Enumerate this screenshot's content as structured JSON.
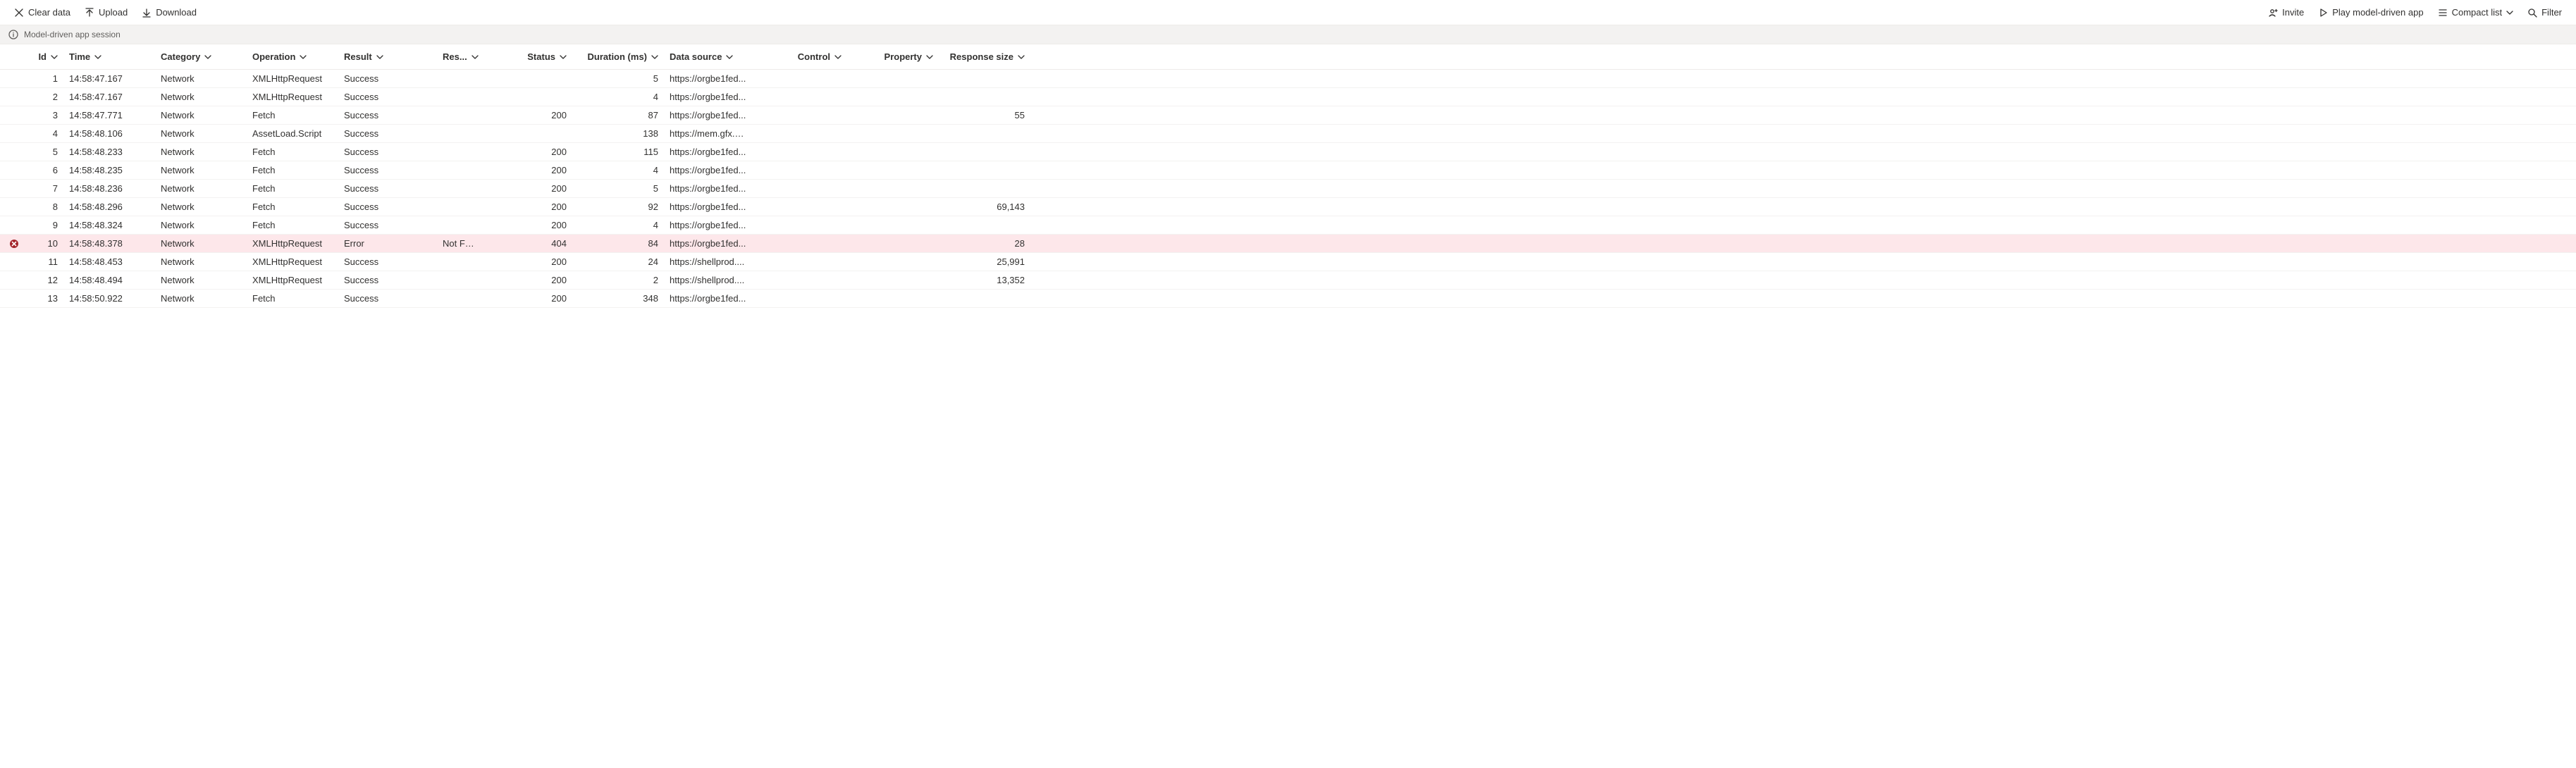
{
  "toolbar": {
    "clear_label": "Clear data",
    "upload_label": "Upload",
    "download_label": "Download",
    "invite_label": "Invite",
    "play_label": "Play model-driven app",
    "compact_label": "Compact list",
    "filter_label": "Filter"
  },
  "session": {
    "label": "Model-driven app session"
  },
  "columns": {
    "id": "Id",
    "time": "Time",
    "category": "Category",
    "operation": "Operation",
    "result": "Result",
    "resultinfo": "Res...",
    "status": "Status",
    "duration": "Duration (ms)",
    "datasource": "Data source",
    "control": "Control",
    "property": "Property",
    "responsesize": "Response size"
  },
  "rows": [
    {
      "id": "1",
      "time": "14:58:47.167",
      "category": "Network",
      "operation": "XMLHttpRequest",
      "result": "Success",
      "resultinfo": "",
      "status": "",
      "duration": "5",
      "datasource": "https://orgbe1fed...",
      "control": "",
      "property": "",
      "responsesize": "",
      "error": false
    },
    {
      "id": "2",
      "time": "14:58:47.167",
      "category": "Network",
      "operation": "XMLHttpRequest",
      "result": "Success",
      "resultinfo": "",
      "status": "",
      "duration": "4",
      "datasource": "https://orgbe1fed...",
      "control": "",
      "property": "",
      "responsesize": "",
      "error": false
    },
    {
      "id": "3",
      "time": "14:58:47.771",
      "category": "Network",
      "operation": "Fetch",
      "result": "Success",
      "resultinfo": "",
      "status": "200",
      "duration": "87",
      "datasource": "https://orgbe1fed...",
      "control": "",
      "property": "",
      "responsesize": "55",
      "error": false
    },
    {
      "id": "4",
      "time": "14:58:48.106",
      "category": "Network",
      "operation": "AssetLoad.Script",
      "result": "Success",
      "resultinfo": "",
      "status": "",
      "duration": "138",
      "datasource": "https://mem.gfx.m...",
      "control": "",
      "property": "",
      "responsesize": "",
      "error": false
    },
    {
      "id": "5",
      "time": "14:58:48.233",
      "category": "Network",
      "operation": "Fetch",
      "result": "Success",
      "resultinfo": "",
      "status": "200",
      "duration": "115",
      "datasource": "https://orgbe1fed...",
      "control": "",
      "property": "",
      "responsesize": "",
      "error": false
    },
    {
      "id": "6",
      "time": "14:58:48.235",
      "category": "Network",
      "operation": "Fetch",
      "result": "Success",
      "resultinfo": "",
      "status": "200",
      "duration": "4",
      "datasource": "https://orgbe1fed...",
      "control": "",
      "property": "",
      "responsesize": "",
      "error": false
    },
    {
      "id": "7",
      "time": "14:58:48.236",
      "category": "Network",
      "operation": "Fetch",
      "result": "Success",
      "resultinfo": "",
      "status": "200",
      "duration": "5",
      "datasource": "https://orgbe1fed...",
      "control": "",
      "property": "",
      "responsesize": "",
      "error": false
    },
    {
      "id": "8",
      "time": "14:58:48.296",
      "category": "Network",
      "operation": "Fetch",
      "result": "Success",
      "resultinfo": "",
      "status": "200",
      "duration": "92",
      "datasource": "https://orgbe1fed...",
      "control": "",
      "property": "",
      "responsesize": "69,143",
      "error": false
    },
    {
      "id": "9",
      "time": "14:58:48.324",
      "category": "Network",
      "operation": "Fetch",
      "result": "Success",
      "resultinfo": "",
      "status": "200",
      "duration": "4",
      "datasource": "https://orgbe1fed...",
      "control": "",
      "property": "",
      "responsesize": "",
      "error": false
    },
    {
      "id": "10",
      "time": "14:58:48.378",
      "category": "Network",
      "operation": "XMLHttpRequest",
      "result": "Error",
      "resultinfo": "Not Fou...",
      "status": "404",
      "duration": "84",
      "datasource": "https://orgbe1fed...",
      "control": "",
      "property": "",
      "responsesize": "28",
      "error": true
    },
    {
      "id": "11",
      "time": "14:58:48.453",
      "category": "Network",
      "operation": "XMLHttpRequest",
      "result": "Success",
      "resultinfo": "",
      "status": "200",
      "duration": "24",
      "datasource": "https://shellprod....",
      "control": "",
      "property": "",
      "responsesize": "25,991",
      "error": false
    },
    {
      "id": "12",
      "time": "14:58:48.494",
      "category": "Network",
      "operation": "XMLHttpRequest",
      "result": "Success",
      "resultinfo": "",
      "status": "200",
      "duration": "2",
      "datasource": "https://shellprod....",
      "control": "",
      "property": "",
      "responsesize": "13,352",
      "error": false
    },
    {
      "id": "13",
      "time": "14:58:50.922",
      "category": "Network",
      "operation": "Fetch",
      "result": "Success",
      "resultinfo": "",
      "status": "200",
      "duration": "348",
      "datasource": "https://orgbe1fed...",
      "control": "",
      "property": "",
      "responsesize": "",
      "error": false
    }
  ]
}
